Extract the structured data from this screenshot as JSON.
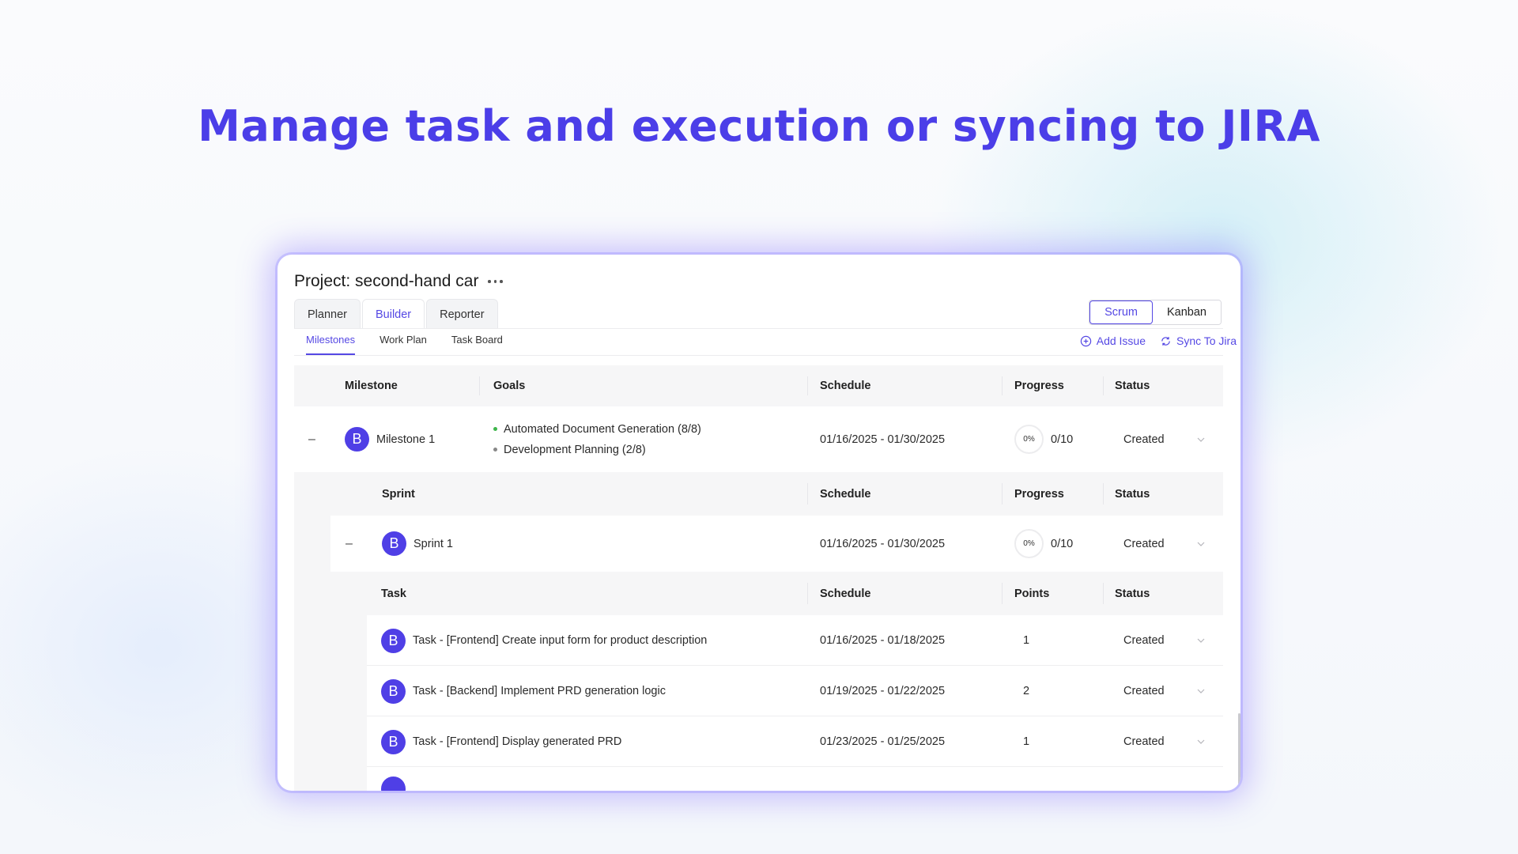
{
  "headline": "Manage task and execution or syncing to JIRA",
  "project": {
    "title": "Project: second-hand car"
  },
  "main_tabs": [
    "Planner",
    "Builder",
    "Reporter"
  ],
  "active_main_tab": "Builder",
  "view_toggle": {
    "options": [
      "Scrum",
      "Kanban"
    ],
    "active": "Scrum"
  },
  "sub_tabs": [
    "Milestones",
    "Work Plan",
    "Task Board"
  ],
  "active_sub_tab": "Milestones",
  "actions": {
    "add_issue": "Add Issue",
    "sync": "Sync To Jira"
  },
  "milestone_header": {
    "milestone": "Milestone",
    "goals": "Goals",
    "schedule": "Schedule",
    "progress": "Progress",
    "status": "Status"
  },
  "milestone": {
    "collapse": "–",
    "avatar": "B",
    "name": "Milestone 1",
    "goals": [
      {
        "text": "Automated Document Generation (8/8)",
        "color": "#3db54a"
      },
      {
        "text": "Development Planning (2/8)",
        "color": "#888888"
      }
    ],
    "schedule": "01/16/2025 - 01/30/2025",
    "progress_pct": "0%",
    "progress_count": "0/10",
    "status": "Created"
  },
  "sprint_header": {
    "sprint": "Sprint",
    "schedule": "Schedule",
    "progress": "Progress",
    "status": "Status"
  },
  "sprint": {
    "collapse": "–",
    "avatar": "B",
    "name": "Sprint 1",
    "schedule": "01/16/2025 - 01/30/2025",
    "progress_pct": "0%",
    "progress_count": "0/10",
    "status": "Created"
  },
  "task_header": {
    "task": "Task",
    "schedule": "Schedule",
    "points": "Points",
    "status": "Status"
  },
  "tasks": [
    {
      "avatar": "B",
      "name": "Task - [Frontend] Create input form for product description",
      "schedule": "01/16/2025 - 01/18/2025",
      "points": "1",
      "status": "Created"
    },
    {
      "avatar": "B",
      "name": "Task - [Backend] Implement PRD generation logic",
      "schedule": "01/19/2025 - 01/22/2025",
      "points": "2",
      "status": "Created"
    },
    {
      "avatar": "B",
      "name": "Task - [Frontend] Display generated PRD",
      "schedule": "01/23/2025 - 01/25/2025",
      "points": "1",
      "status": "Created"
    }
  ],
  "colors": {
    "accent": "#5548e4",
    "avatar": "#4f3fe6",
    "headline": "#4b3ee8"
  }
}
